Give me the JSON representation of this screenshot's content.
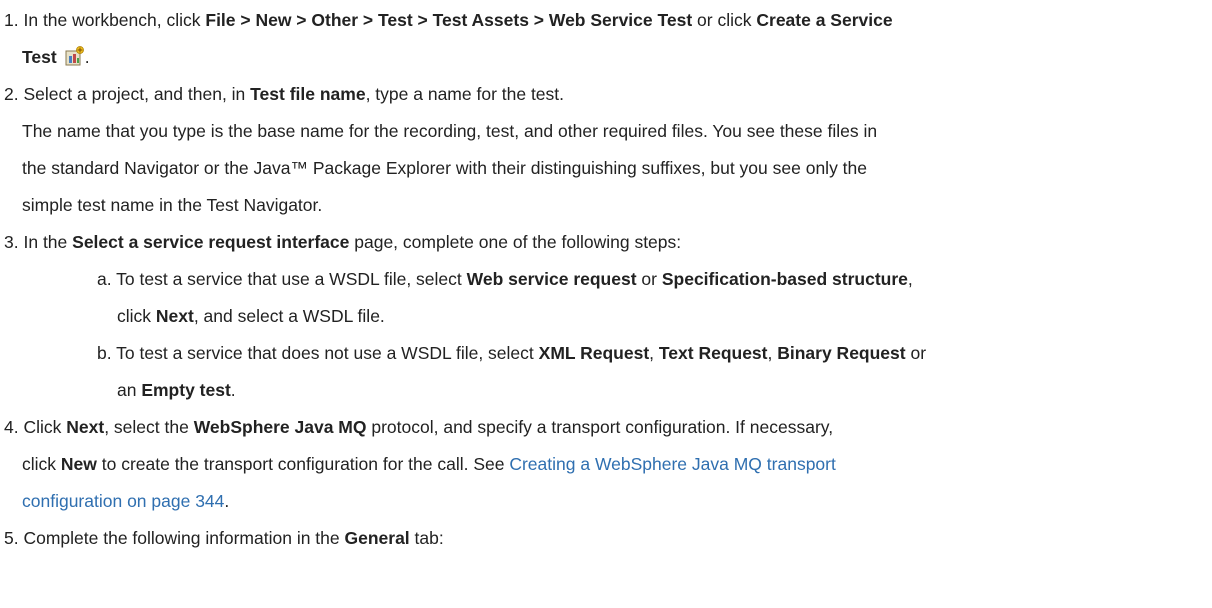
{
  "steps": [
    {
      "num": "1.",
      "p1": "In the workbench, click ",
      "b1": "File > New > Other > Test > Test Assets > Web Service Test",
      "p2": " or click ",
      "b2": "Create a Service",
      "b3": "Test",
      "p3": ".",
      "icon": "create-service-test-icon"
    },
    {
      "num": "2.",
      "p1": "Select a project, and then, in ",
      "b1": "Test file name",
      "p2": ", type a name for the test.",
      "l2": "The name that you type is the base name for the recording, test, and other required files. You see these files in",
      "l3": "the standard Navigator or the Java™ Package Explorer with their distinguishing suffixes, but you see only the",
      "l4": "simple test name in the Test Navigator."
    },
    {
      "num": "3.",
      "p1": "In the ",
      "b1": "Select a service request interface",
      "p2": " page, complete one of the following steps:",
      "sub_a": {
        "letter": "a.",
        "p1": "To test a service that use a WSDL file, select ",
        "b1": "Web service request",
        "p2": " or ",
        "b2": "Specification-based structure",
        "p3": ",",
        "l2p1": "click ",
        "l2b1": "Next",
        "l2p2": ", and select a WSDL file."
      },
      "sub_b": {
        "letter": "b.",
        "p1": "To test a service that does not use a WSDL file, select ",
        "b1": "XML Request",
        "p2": ", ",
        "b2": "Text Request",
        "p3": ", ",
        "b3": "Binary Request",
        "p4": " or",
        "l2p1": "an ",
        "l2b1": "Empty test",
        "l2p2": "."
      }
    },
    {
      "num": "4.",
      "p1": "Click ",
      "b1": "Next",
      "p2": ", select the ",
      "b2": "WebSphere Java MQ",
      "p3": " protocol, and specify a transport configuration. If necessary,",
      "l2p1": "click ",
      "l2b1": "New",
      "l2p2": " to create the transport configuration for the call. See ",
      "link1": "Creating a WebSphere Java MQ transport",
      "link2": "configuration on page 344",
      "l3p2": "."
    },
    {
      "num": "5.",
      "p1": "Complete the following information in the ",
      "b1": "General",
      "p2": " tab:"
    }
  ],
  "colors": {
    "text": "#222222",
    "link": "#2f6fb0"
  }
}
